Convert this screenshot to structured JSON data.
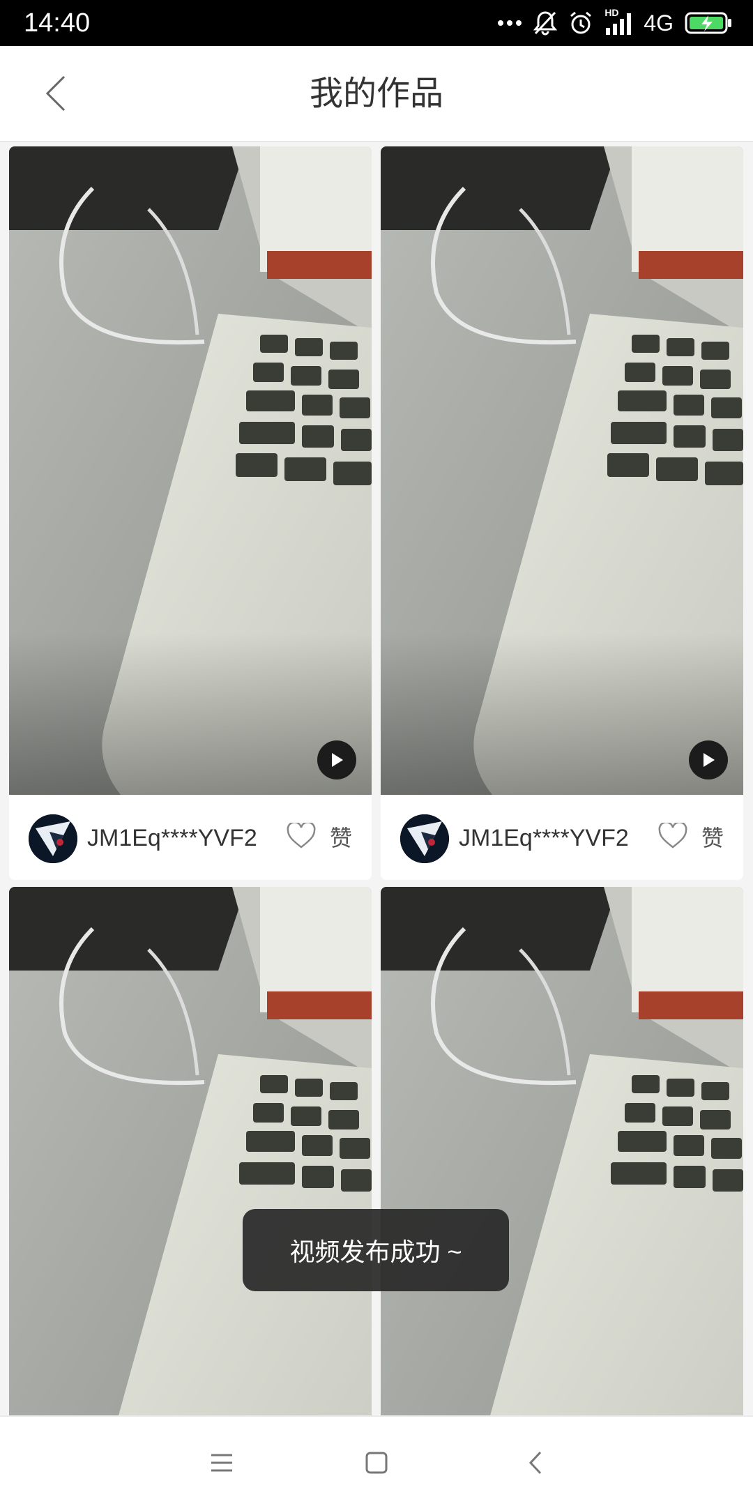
{
  "status_bar": {
    "time": "14:40",
    "network": "4G",
    "icons": [
      "more-dots-icon",
      "mute-bell-icon",
      "alarm-icon",
      "signal-icon",
      "battery-charging-icon"
    ],
    "hd_label": "HD"
  },
  "header": {
    "title": "我的作品",
    "back_icon": "back-chevron-icon"
  },
  "cards": [
    {
      "author": "JM1Eq****YVF2",
      "like_label": "赞",
      "thumbnail": "laptop-keyboard-photo"
    },
    {
      "author": "JM1Eq****YVF2",
      "like_label": "赞",
      "thumbnail": "laptop-keyboard-photo"
    },
    {
      "author": "",
      "like_label": "",
      "thumbnail": "laptop-keyboard-photo"
    },
    {
      "author": "",
      "like_label": "",
      "thumbnail": "laptop-keyboard-photo"
    }
  ],
  "toast": {
    "message": "视频发布成功 ~"
  },
  "nav_bar": {
    "icons": [
      "menu-icon",
      "home-square-icon",
      "back-icon"
    ]
  },
  "colors": {
    "status_bar_bg": "#000000",
    "battery_green": "#4cd964",
    "toast_bg": "#282828"
  }
}
